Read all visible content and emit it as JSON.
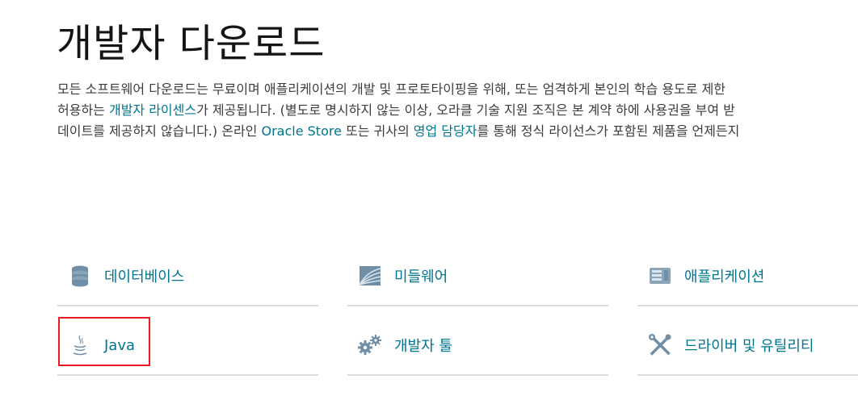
{
  "page": {
    "title": "개발자 다운로드",
    "intro": {
      "l1_a": "모든 소프트웨어 다운로드는 무료이며 애플리케이션의 개발 및 프로토타이핑을 위해, 또는 엄격하게 본인의 학습 용도로 제한",
      "l2_a": "허용하는 ",
      "l2_link": "개발자 라이센스",
      "l2_b": "가 제공됩니다. (별도로 명시하지 않는 이상, 오라클 기술 지원 조직은 본 계약 하에 사용권을 부여 받",
      "l3_a": "데이트를 제공하지 않습니다.) 온라인 ",
      "l3_link1": "Oracle Store",
      "l3_b": " 또는 귀사의 ",
      "l3_link2": "영업 담당자",
      "l3_c": "를 통해 정식 라이선스가 포함된 제품을 언제든지"
    }
  },
  "categories": [
    {
      "label": "데이터베이스",
      "icon": "database-icon"
    },
    {
      "label": "미들웨어",
      "icon": "middleware-icon"
    },
    {
      "label": "애플리케이션",
      "icon": "application-server-icon"
    },
    {
      "label": "Java",
      "icon": "java-cup-icon"
    },
    {
      "label": "개발자 툴",
      "icon": "gears-icon"
    },
    {
      "label": "드라이버 및 유틸리티",
      "icon": "tools-icon"
    }
  ],
  "colors": {
    "link": "#00758f",
    "highlight": "#e8191f",
    "icon": "#6f8fa8"
  }
}
